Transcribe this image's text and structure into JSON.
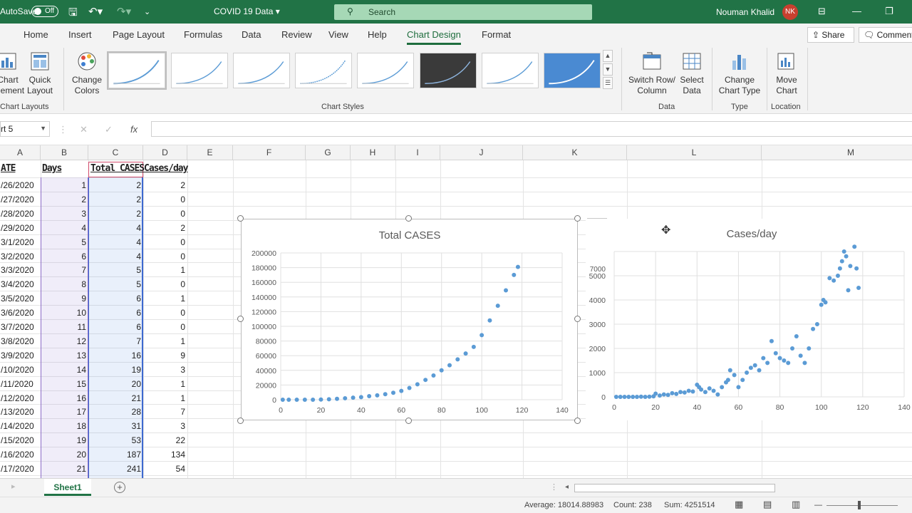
{
  "titlebar": {
    "autosave_label": "AutoSave",
    "autosave_state": "Off",
    "document_title": "COVID 19 Data ▾",
    "search_placeholder": "Search",
    "user_name": "Nouman Khalid",
    "user_initials": "NK"
  },
  "tabs": [
    "Home",
    "Insert",
    "Page Layout",
    "Formulas",
    "Data",
    "Review",
    "View",
    "Help",
    "Chart Design",
    "Format"
  ],
  "active_tab": "Chart Design",
  "share_label": "Share",
  "comments_label": "Comments",
  "ribbon": {
    "add_chart_element": "Chart Element",
    "quick_layout": "Quick Layout",
    "change_colors": "Change Colors",
    "chart_layouts_label": "Chart Layouts",
    "chart_styles_label": "Chart Styles",
    "switch_row_column": "Switch Row/ Column",
    "select_data": "Select Data",
    "data_label": "Data",
    "change_chart_type": "Change Chart Type",
    "type_label": "Type",
    "move_chart": "Move Chart",
    "location_label": "Location"
  },
  "namebox": "rt 5",
  "columns": [
    "A",
    "B",
    "C",
    "D",
    "E",
    "F",
    "G",
    "H",
    "I",
    "J",
    "K",
    "L",
    "M"
  ],
  "table": {
    "headers": [
      "ATE",
      "Days",
      "Total CASES",
      "Cases/day"
    ],
    "rows": [
      [
        "/26/2020",
        "1",
        "2",
        "2"
      ],
      [
        "/27/2020",
        "2",
        "2",
        "0"
      ],
      [
        "/28/2020",
        "3",
        "2",
        "0"
      ],
      [
        "/29/2020",
        "4",
        "4",
        "2"
      ],
      [
        "3/1/2020",
        "5",
        "4",
        "0"
      ],
      [
        "3/2/2020",
        "6",
        "4",
        "0"
      ],
      [
        "3/3/2020",
        "7",
        "5",
        "1"
      ],
      [
        "3/4/2020",
        "8",
        "5",
        "0"
      ],
      [
        "3/5/2020",
        "9",
        "6",
        "1"
      ],
      [
        "3/6/2020",
        "10",
        "6",
        "0"
      ],
      [
        "3/7/2020",
        "11",
        "6",
        "0"
      ],
      [
        "3/8/2020",
        "12",
        "7",
        "1"
      ],
      [
        "3/9/2020",
        "13",
        "16",
        "9"
      ],
      [
        "/10/2020",
        "14",
        "19",
        "3"
      ],
      [
        "/11/2020",
        "15",
        "20",
        "1"
      ],
      [
        "/12/2020",
        "16",
        "21",
        "1"
      ],
      [
        "/13/2020",
        "17",
        "28",
        "7"
      ],
      [
        "/14/2020",
        "18",
        "31",
        "3"
      ],
      [
        "/15/2020",
        "19",
        "53",
        "22"
      ],
      [
        "/16/2020",
        "20",
        "187",
        "134"
      ],
      [
        "/17/2020",
        "21",
        "241",
        "54"
      ]
    ]
  },
  "chart_data": [
    {
      "type": "scatter",
      "title": "Total CASES",
      "xlim": [
        0,
        140
      ],
      "ylim": [
        0,
        200000
      ],
      "xticks": [
        "0",
        "20",
        "40",
        "60",
        "80",
        "100",
        "120",
        "140"
      ],
      "yticks": [
        "0",
        "20000",
        "40000",
        "60000",
        "80000",
        "100000",
        "120000",
        "140000",
        "160000",
        "180000",
        "200000"
      ],
      "grid": true,
      "color": "#5b9bd5",
      "x": [
        1,
        4,
        8,
        12,
        16,
        20,
        24,
        28,
        32,
        36,
        40,
        44,
        48,
        52,
        56,
        60,
        64,
        68,
        72,
        76,
        80,
        84,
        88,
        92,
        96,
        100,
        104,
        108,
        112,
        116,
        118
      ],
      "y": [
        2,
        4,
        6,
        7,
        21,
        187,
        600,
        1200,
        2000,
        2800,
        3500,
        4800,
        6000,
        7500,
        9500,
        12000,
        16000,
        21000,
        27000,
        33000,
        40000,
        47000,
        55000,
        63000,
        72000,
        88000,
        108000,
        128000,
        149000,
        170000,
        181000
      ]
    },
    {
      "type": "scatter",
      "title": "Cases/day",
      "xlim": [
        0,
        140
      ],
      "ylim": [
        0,
        7000
      ],
      "xticks": [
        "0",
        "20",
        "40",
        "60",
        "80",
        "100",
        "120",
        "140"
      ],
      "yticks": [
        "0",
        "1000",
        "2000",
        "3000",
        "4000",
        "5000",
        "7000"
      ],
      "grid": true,
      "color": "#5b9bd5",
      "x": [
        1,
        3,
        5,
        7,
        9,
        11,
        13,
        15,
        17,
        19,
        20,
        22,
        24,
        26,
        28,
        30,
        32,
        34,
        36,
        38,
        40,
        41,
        42,
        44,
        46,
        48,
        50,
        52,
        54,
        55,
        56,
        58,
        60,
        62,
        64,
        66,
        68,
        70,
        72,
        74,
        76,
        78,
        80,
        82,
        84,
        86,
        88,
        90,
        92,
        94,
        96,
        98,
        100,
        101,
        102,
        104,
        106,
        108,
        109,
        110,
        111,
        112,
        113,
        114,
        116,
        117,
        118
      ],
      "y": [
        0,
        0,
        0,
        1,
        1,
        0,
        9,
        1,
        7,
        22,
        134,
        54,
        100,
        80,
        150,
        120,
        200,
        180,
        250,
        220,
        500,
        400,
        300,
        200,
        350,
        250,
        100,
        400,
        600,
        700,
        1100,
        900,
        400,
        700,
        1000,
        1200,
        1300,
        1100,
        1600,
        1400,
        2300,
        1800,
        1600,
        1500,
        1400,
        2000,
        2500,
        1700,
        1400,
        2000,
        2800,
        3000,
        3800,
        4000,
        3900,
        4900,
        4800,
        5000,
        5300,
        5600,
        6000,
        5800,
        4400,
        5400,
        6200,
        5300,
        4500
      ]
    }
  ],
  "status": {
    "average": "Average: 18014.88983",
    "count": "Count: 238",
    "sum": "Sum: 4251514"
  },
  "sheet_tab": "Sheet1"
}
